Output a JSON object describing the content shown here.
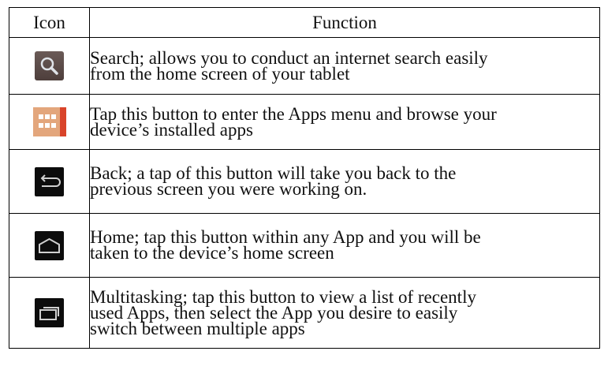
{
  "table": {
    "headers": {
      "icon": "Icon",
      "function": "Function"
    },
    "rows": [
      {
        "icon": "search-icon",
        "lines": [
          "Search; allows you to conduct an internet search easily",
          "from the home screen of your tablet"
        ]
      },
      {
        "icon": "apps-grid-icon",
        "lines": [
          "Tap this button to enter the Apps menu and browse your",
          "device’s installed apps"
        ]
      },
      {
        "icon": "back-arrow-icon",
        "lines": [
          "Back; a tap of this button will take you back to the",
          "previous screen you were working on."
        ]
      },
      {
        "icon": "home-icon",
        "lines": [
          "Home; tap this button within any App and you will be",
          "taken to the device’s home screen"
        ]
      },
      {
        "icon": "multitasking-icon",
        "lines": [
          "Multitasking; tap this button to view a list of recently",
          "used Apps, then select the App you desire to easily",
          "switch between multiple apps"
        ]
      }
    ]
  },
  "colors": {
    "search_bg": "#5a4a47",
    "apps_bg": "#e3a67c",
    "apps_accent": "#d9442a",
    "nav_bg": "#0c0c0c",
    "nav_stroke": "#cfcfcf"
  }
}
